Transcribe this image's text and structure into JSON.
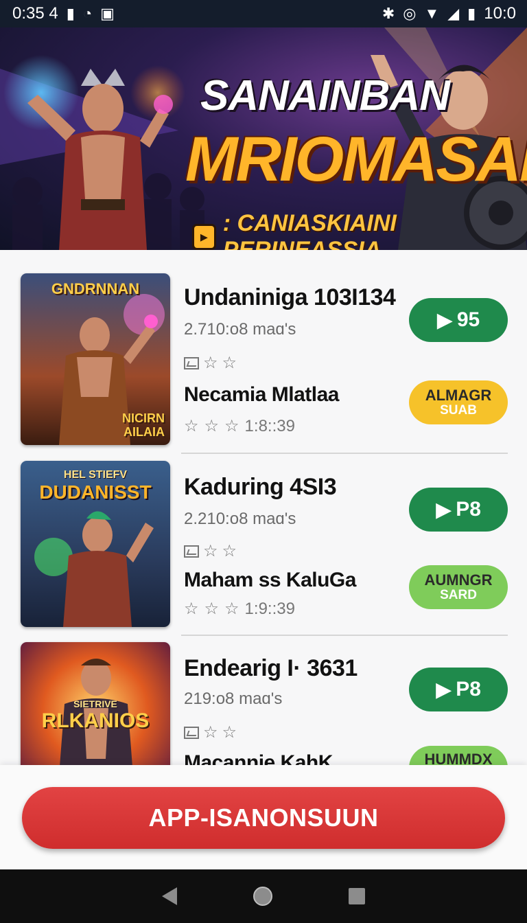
{
  "status_bar": {
    "time": "0:35 4",
    "right_text": "10:0",
    "icons": [
      "sim-icon",
      "circle-status-icon",
      "media-icon",
      "bluetooth-icon",
      "alarm-icon",
      "wifi-icon",
      "signal-icon",
      "battery-icon"
    ]
  },
  "banner": {
    "title_line1": "SANAINBAN",
    "title_line2": "MRIOMASAN",
    "subtitle": ": CANIASKIAINI PERINEASSIA"
  },
  "games": [
    {
      "thumb_title": "GNDRNNAN",
      "thumb_corner": "NICIRN AILAIA",
      "title": "Undaniniga 103I134",
      "meta": "2.710:o8 maɑ's",
      "sub_title": "Necamia Mlatlaa",
      "stars_meta": "1:8::39",
      "price_button": "95",
      "pill_line1": "ALMAGR",
      "pill_line2": "SUAB",
      "pill_color": "#f6c22a"
    },
    {
      "thumb_title": "DUDANISST",
      "thumb_subtitle": "HEL STIEFV",
      "title": "Kaduring 4SI3",
      "meta": "2.210:o8 maɑ's",
      "sub_title": "Maham ss KaluGa",
      "stars_meta": "1:9::39",
      "price_button": "P8",
      "pill_line1": "AUMNGR",
      "pill_line2": "SARD",
      "pill_color": "#7fcc5a"
    },
    {
      "thumb_title": "RLKANIOS",
      "thumb_subtitle": "SIETRIVE",
      "title": "Endearig I· 3631",
      "meta": "219:o8 maɑ's",
      "sub_title": "Macannie KahK",
      "price_button": "P8",
      "pill_line1": "HUMMDX",
      "pill_color": "#7fcc5a"
    }
  ],
  "cta": {
    "label": "APP-ISANONSUUN"
  },
  "colors": {
    "accent_green": "#1f8a4c",
    "cta_red": "#d93636",
    "status_bar": "#141d2c"
  }
}
